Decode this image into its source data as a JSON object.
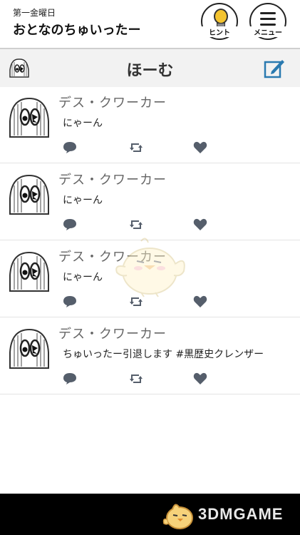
{
  "app": {
    "week_label": "第一金曜日",
    "title": "おとなのちゅいったー",
    "hint_label": "ヒント",
    "menu_label": "メニュー"
  },
  "header": {
    "title": "ほーむ"
  },
  "tweets": [
    {
      "name": "デス・クワーカー",
      "text": "にゃーん"
    },
    {
      "name": "デス・クワーカー",
      "text": "にゃーん"
    },
    {
      "name": "デス・クワーカー",
      "text": "にゃーん"
    },
    {
      "name": "デス・クワーカー",
      "text": "ちゅいったー引退します #黒歴史クレンザー"
    }
  ],
  "footer": {
    "brand": "3DMGAME"
  },
  "colors": {
    "action_icon": "#555e6b",
    "header_bg": "#f2f2f2",
    "compose_icon": "#2a7ab0",
    "footer_bg": "#000000"
  },
  "icons": {
    "reply": "speech-bubble-icon",
    "retweet": "retweet-icon",
    "like": "heart-icon",
    "compose": "compose-icon"
  }
}
